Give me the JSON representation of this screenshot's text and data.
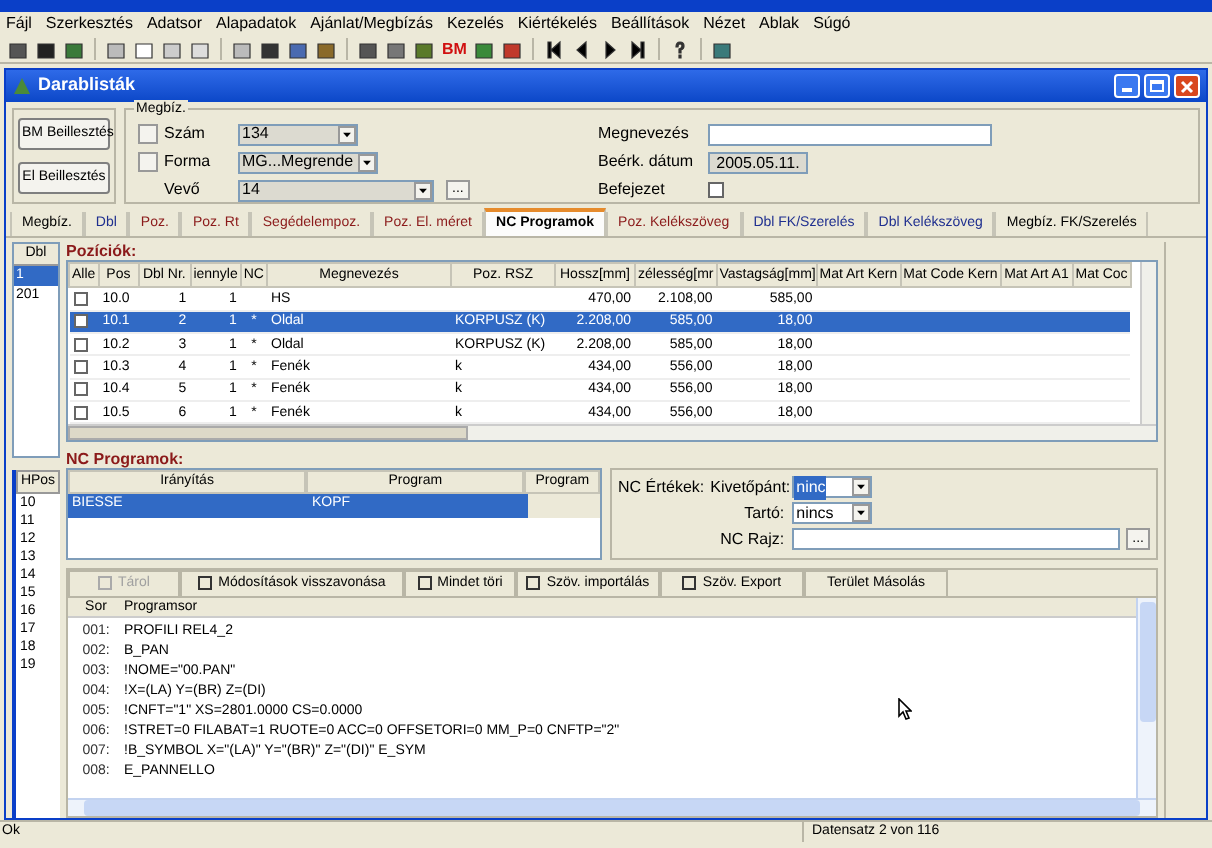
{
  "menu": [
    "Fájl",
    "Szerkesztés",
    "Adatsor",
    "Alapadatok",
    "Ajánlat/Megbízás",
    "Kezelés",
    "Kiértékelés",
    "Beállítások",
    "Nézet",
    "Ablak",
    "Súgó"
  ],
  "toolbar": {
    "label": "BM"
  },
  "window": {
    "title": "Darablisták"
  },
  "header": {
    "buttons": [
      "BM Beillesztés",
      "El Beillesztés"
    ],
    "group_title": "Megbíz.",
    "fields": [
      {
        "label": "Szám",
        "value": "134",
        "kind": "combo"
      },
      {
        "label": "Forma",
        "value": "MG...Megrende",
        "kind": "combo"
      },
      {
        "label": "Vevő",
        "value": "14",
        "kind": "combo",
        "button": "..."
      }
    ],
    "right_fields": [
      {
        "label": "Megnevezés",
        "kind": "text"
      },
      {
        "label": "Beérk. dátum",
        "value": "2005.05.11.",
        "kind": "readonly"
      },
      {
        "label": "Befejezet",
        "checked": false,
        "kind": "check"
      }
    ]
  },
  "tabs": [
    {
      "label": "Megbíz.",
      "selected": false,
      "color": "#000000"
    },
    {
      "label": "Dbl",
      "selected": false,
      "color": "#1f2f8f"
    },
    {
      "label": "Poz.",
      "selected": false,
      "color": "#8b1a1a"
    },
    {
      "label": "Poz. Rt",
      "selected": false,
      "color": "#8b1a1a"
    },
    {
      "label": "Segédelempoz.",
      "selected": false,
      "color": "#8b1a1a"
    },
    {
      "label": "Poz. El. méret",
      "selected": false,
      "color": "#8b1a1a"
    },
    {
      "label": "NC Programok",
      "selected": true,
      "color": "#000000"
    },
    {
      "label": "Poz. Kelékszöveg",
      "selected": false,
      "color": "#8b1a1a"
    },
    {
      "label": "Dbl FK/Szerelés",
      "selected": false,
      "color": "#1f2f8f"
    },
    {
      "label": "Dbl Kelékszöveg",
      "selected": false,
      "color": "#1f2f8f"
    },
    {
      "label": "Megbíz. FK/Szerelés",
      "selected": false,
      "color": "#000000"
    }
  ],
  "dbl_list": {
    "header": "Dbl",
    "items": [
      {
        "label": "1",
        "selected": true
      },
      {
        "label": "201",
        "selected": false
      }
    ]
  },
  "positions": {
    "title": "Pozíciók:",
    "columns": [
      "Alle",
      "Pos",
      "Dbl Nr.",
      "iennyle",
      "NC",
      "Megnevezés",
      "Poz. RSZ",
      "Hossz[mm]",
      "zélesség[mr",
      "Vastagság[mm]",
      "Mat Art Kern",
      "Mat Code Kern",
      "Mat Art A1",
      "Mat Coc"
    ],
    "rows": [
      {
        "checked": false,
        "selected": false,
        "cells": [
          "",
          "10.0",
          "1",
          "1",
          "",
          "HS",
          "",
          "470,00",
          "2.108,00",
          "585,00",
          "",
          "",
          "",
          ""
        ]
      },
      {
        "checked": false,
        "selected": true,
        "cells": [
          "",
          "10.1",
          "2",
          "1",
          "*",
          "Oldal",
          "KORPUSZ (K)",
          "2.208,00",
          "585,00",
          "18,00",
          "",
          "",
          "",
          ""
        ]
      },
      {
        "checked": false,
        "selected": false,
        "cells": [
          "",
          "10.2",
          "3",
          "1",
          "*",
          "Oldal",
          "KORPUSZ (K)",
          "2.208,00",
          "585,00",
          "18,00",
          "",
          "",
          "",
          ""
        ]
      },
      {
        "checked": false,
        "selected": false,
        "cells": [
          "",
          "10.3",
          "4",
          "1",
          "*",
          "Fenék",
          "k",
          "434,00",
          "556,00",
          "18,00",
          "",
          "",
          "",
          ""
        ]
      },
      {
        "checked": false,
        "selected": false,
        "cells": [
          "",
          "10.4",
          "5",
          "1",
          "*",
          "Fenék",
          "k",
          "434,00",
          "556,00",
          "18,00",
          "",
          "",
          "",
          ""
        ]
      },
      {
        "checked": false,
        "selected": false,
        "cells": [
          "",
          "10.5",
          "6",
          "1",
          "*",
          "Fenék",
          "k",
          "434,00",
          "556,00",
          "18,00",
          "",
          "",
          "",
          ""
        ]
      }
    ]
  },
  "nc_programs": {
    "title": "NC Programok:",
    "columns": [
      "Irányítás",
      "Program",
      "Program"
    ],
    "rows": [
      {
        "selected": true,
        "cells": [
          "BIESSE",
          "KOPF",
          ""
        ]
      }
    ]
  },
  "nc_values": {
    "title": "NC Értékek:",
    "fields": [
      {
        "label": "Kivetőpánt:",
        "value": "ninc",
        "kind": "combo",
        "selected": true
      },
      {
        "label": "Tartó:",
        "value": "nincs",
        "kind": "combo",
        "selected": false
      },
      {
        "label": "NC Rajz:",
        "kind": "text",
        "button": "..."
      }
    ]
  },
  "hpos_list": {
    "header": "HPos",
    "items": [
      "10",
      "11",
      "12",
      "13",
      "14",
      "15",
      "16",
      "17",
      "18",
      "19"
    ]
  },
  "editor_buttons": [
    {
      "label": "Tárol",
      "disabled": true
    },
    {
      "label": "Módosítások visszavonása",
      "disabled": false
    },
    {
      "label": "Mindet töri",
      "disabled": false
    },
    {
      "label": "Szöv. importálás",
      "disabled": false
    },
    {
      "label": "Szöv. Export",
      "disabled": false
    },
    {
      "label": "Terület Másolás",
      "disabled": false
    }
  ],
  "editor": {
    "columns": [
      "Sor",
      "Programsor"
    ],
    "lines": [
      [
        "001:",
        "PROFILI REL4_2"
      ],
      [
        "002:",
        "B_PAN"
      ],
      [
        "003:",
        "!NOME=\"00.PAN\""
      ],
      [
        "004:",
        "!X=(LA) Y=(BR) Z=(DI)"
      ],
      [
        "005:",
        "!CNFT=\"1\" XS=2801.0000 CS=0.0000"
      ],
      [
        "006:",
        "!STRET=0 FILABAT=1 RUOTE=0 ACC=0 OFFSETORI=0 MM_P=0 CNFTP=\"2\""
      ],
      [
        "007:",
        "!B_SYMBOL X=\"(LA)\" Y=\"(BR)\" Z=\"(DI)\" E_SYM"
      ],
      [
        "008:",
        "E_PANNELLO"
      ]
    ]
  },
  "status_bar": {
    "left": "Ok",
    "right": "Datensatz 2 von 116"
  }
}
